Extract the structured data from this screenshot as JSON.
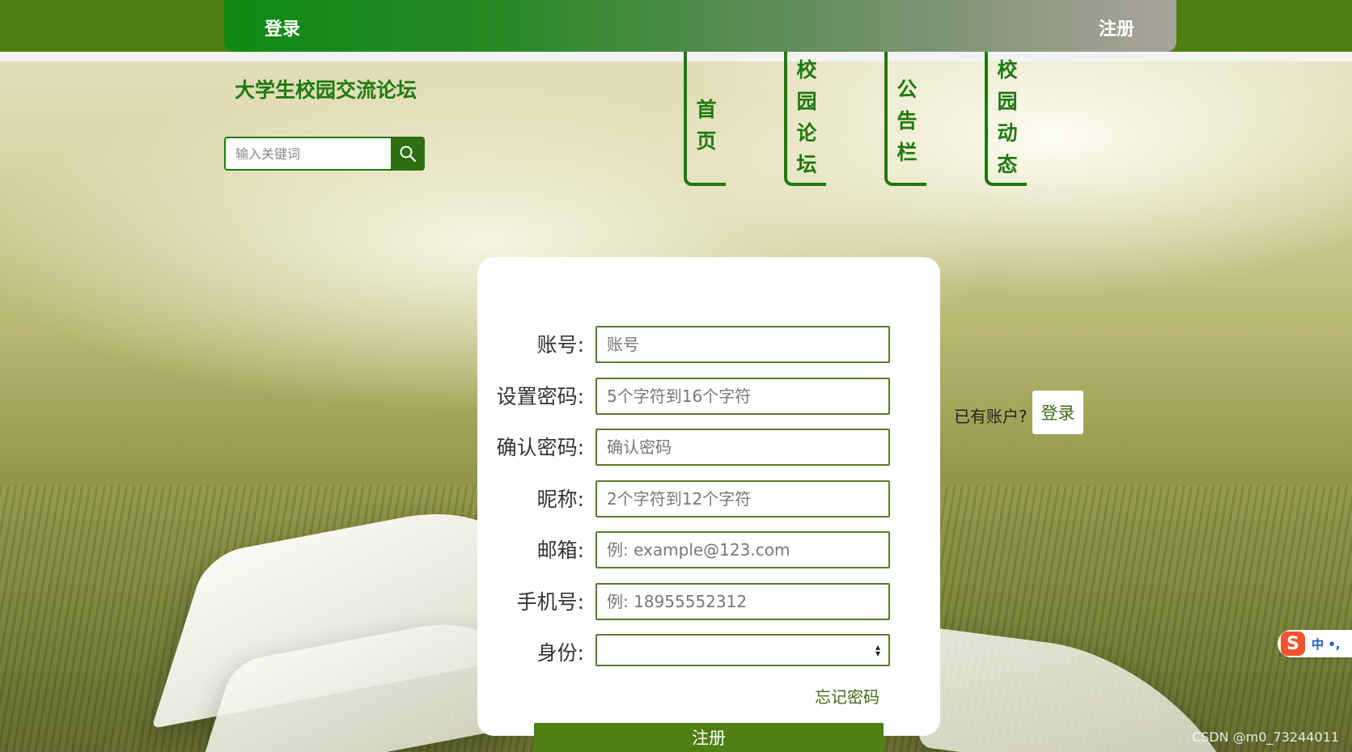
{
  "top_nav": {
    "login_label": "登录",
    "register_label": "注册"
  },
  "site": {
    "title": "大学生校园交流论坛"
  },
  "search": {
    "placeholder": "输入关键词",
    "icon": "search-icon"
  },
  "nav": {
    "items": [
      {
        "chars": [
          "首",
          "页"
        ]
      },
      {
        "chars": [
          "校",
          "园",
          "论",
          "坛"
        ]
      },
      {
        "chars": [
          "公",
          "告",
          "栏"
        ]
      },
      {
        "chars": [
          "校",
          "园",
          "动",
          "态"
        ]
      }
    ]
  },
  "form": {
    "fields": [
      {
        "label": "账号:",
        "placeholder": "账号"
      },
      {
        "label": "设置密码:",
        "placeholder": "5个字符到16个字符"
      },
      {
        "label": "确认密码:",
        "placeholder": "确认密码"
      },
      {
        "label": "昵称:",
        "placeholder": "2个字符到12个字符"
      },
      {
        "label": "邮箱:",
        "placeholder": "例: example@123.com"
      },
      {
        "label": "手机号:",
        "placeholder": "例: 18955552312"
      },
      {
        "label": "身份:",
        "selected": ""
      }
    ],
    "forgot_label": "忘记密码",
    "submit_label": "注册"
  },
  "account": {
    "have_account_text": "已有账户?",
    "login_label": "登录"
  },
  "ime": {
    "logo": "S",
    "text": "中 •,"
  },
  "watermark": "CSDN @m0_73244011",
  "colors": {
    "brand_green": "#4f7e13",
    "text_green": "#1f7a10",
    "link_green": "#3f6b14"
  }
}
